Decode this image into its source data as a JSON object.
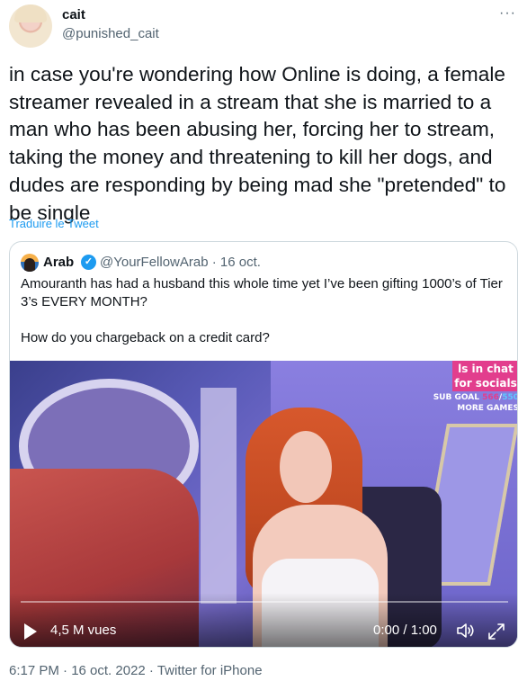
{
  "tweet": {
    "author_name": "cait",
    "author_handle": "@punished_cait",
    "more_label": "···",
    "text": "in case you're wondering how Online is doing, a female streamer revealed in a stream that she is married to a man who has been abusing her, forcing her to stream, taking the money and threatening to kill her dogs, and dudes are responding by being mad she \"pretended\" to be single",
    "translate_label": "Traduire le Tweet",
    "meta": "6:17 PM · 16 oct. 2022 · Twitter for iPhone"
  },
  "quote": {
    "author_name": "Arab",
    "verified_glyph": "✓",
    "handle_date": "@YourFellowArab · 16 oct.",
    "text": "Amouranth has had a husband this whole time yet I’ve been gifting 1000’s of Tier 3’s EVERY MONTH?\n\nHow do you chargeback on a credit card?",
    "video": {
      "overlay_line1": "ls in chat",
      "overlay_line2": "for socials",
      "sub_goal_label": "SUB GOAL",
      "sub_goal_value": "566",
      "sub_goal_sep": "/",
      "sub_goal_target": "550",
      "more_games": "MORE GAMES",
      "views": "4,5 M vues",
      "time": "0:00 / 1:00",
      "progress": 0
    }
  },
  "icons": {
    "play": "play-icon",
    "volume": "volume-icon",
    "expand": "expand-icon",
    "verified": "verified-badge-icon"
  },
  "colors": {
    "accent": "#1d9bf0",
    "text": "#0f1419",
    "muted": "#536471",
    "overlay_pink": "#e23e8d"
  }
}
